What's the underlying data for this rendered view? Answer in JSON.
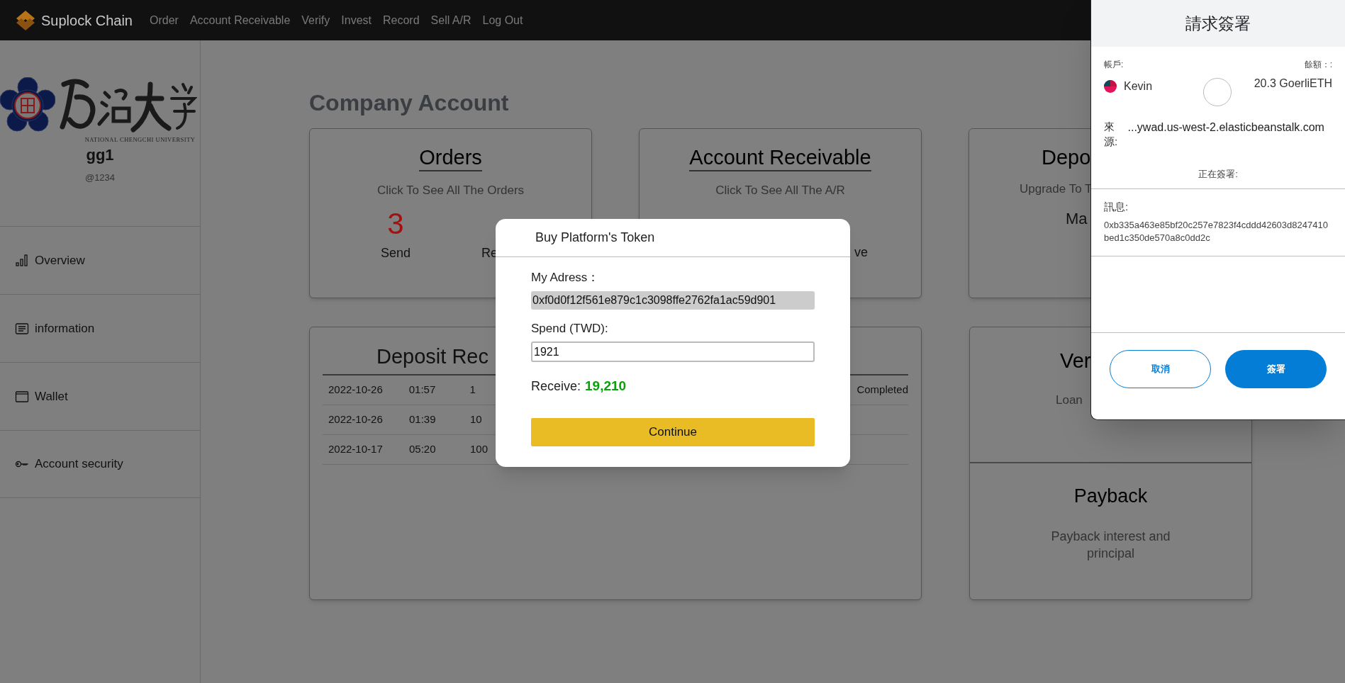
{
  "navbar": {
    "brand": "Suplock Chain",
    "links": [
      "Order",
      "Account Receivable",
      "Verify",
      "Invest",
      "Record",
      "Sell A/R",
      "Log Out"
    ]
  },
  "sidebar": {
    "logo_caption": "NATIONAL CHENGCHI UNIVERSITY",
    "username": "gg1",
    "handle": "@1234",
    "items": [
      {
        "label": "Overview",
        "kind": "chart"
      },
      {
        "label": "information",
        "kind": "document"
      },
      {
        "label": "Wallet",
        "kind": "window"
      },
      {
        "label": "Account security",
        "kind": "key"
      }
    ]
  },
  "page_title": "Company Account",
  "orders_card": {
    "title": "Orders",
    "subtitle": "Click To See All The Orders",
    "count": "3",
    "count_label": "Send",
    "second_label": "Re"
  },
  "ar_card": {
    "title": "Account Receivable",
    "subtitle": "Click To See All The A/R",
    "second_label": "ve"
  },
  "deposit_card": {
    "title": "Depo",
    "subtitle": "Upgrade To T",
    "line": "Ma"
  },
  "deposit_record": {
    "title": "Deposit Rec",
    "rows": [
      {
        "date": "2022-10-26",
        "time": "01:57",
        "amount": "1",
        "status": "Completed"
      },
      {
        "date": "2022-10-26",
        "time": "01:39",
        "amount": "10"
      },
      {
        "date": "2022-10-17",
        "time": "05:20",
        "amount": "100"
      }
    ]
  },
  "verify_card": {
    "title": "Ver",
    "subtitle": "Loan"
  },
  "payback_card": {
    "title": "Payback",
    "subtitle": "Payback interest and principal"
  },
  "modal": {
    "title": "Buy Platform's Token",
    "address_label": "My Adress：",
    "address": "0xf0d0f12f561e879c1c3098ffe2762fa1ac59d901",
    "spend_label": "Spend (TWD):",
    "spend_value": "1921",
    "receive_label": "Receive:",
    "receive_value": "19,210",
    "button": "Continue"
  },
  "signature_popup": {
    "title": "請求簽署",
    "account_label": "帳戶:",
    "account": "Kevin",
    "balance_label": "餘額：:",
    "balance": "20.3 GoerliETH",
    "origin_label": "來源:",
    "origin": "...ywad.us-west-2.elasticbeanstalk.com",
    "signing": "正在簽署:",
    "message_label": "訊息:",
    "message": "0xb335a463e85bf20c257e7823f4cddd42603d8247410bed1c350de570a8c0dd2c",
    "cancel": "取消",
    "sign": "簽署"
  }
}
